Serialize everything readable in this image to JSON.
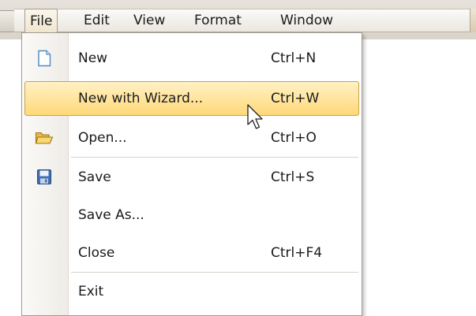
{
  "menubar": {
    "items": [
      {
        "label": "File",
        "active": true
      },
      {
        "label": "Edit"
      },
      {
        "label": "View"
      },
      {
        "label": "Format"
      },
      {
        "label": "Window"
      }
    ]
  },
  "file_menu": {
    "items": [
      {
        "label": "New",
        "shortcut": "Ctrl+N",
        "icon": "new-document-icon"
      },
      {
        "label": "New with Wizard...",
        "shortcut": "Ctrl+W",
        "highlighted": true
      },
      {
        "label": "Open...",
        "shortcut": "Ctrl+O",
        "icon": "folder-open-icon"
      },
      {
        "label": "Save",
        "shortcut": "Ctrl+S",
        "icon": "floppy-disk-icon"
      },
      {
        "label": "Save As...",
        "shortcut": ""
      },
      {
        "label": "Close",
        "shortcut": "Ctrl+F4"
      },
      {
        "label": "Exit",
        "shortcut": ""
      }
    ]
  },
  "colors": {
    "highlight_top": "#fff1c5",
    "highlight_bottom": "#ffd978",
    "highlight_border": "#c9a345"
  }
}
